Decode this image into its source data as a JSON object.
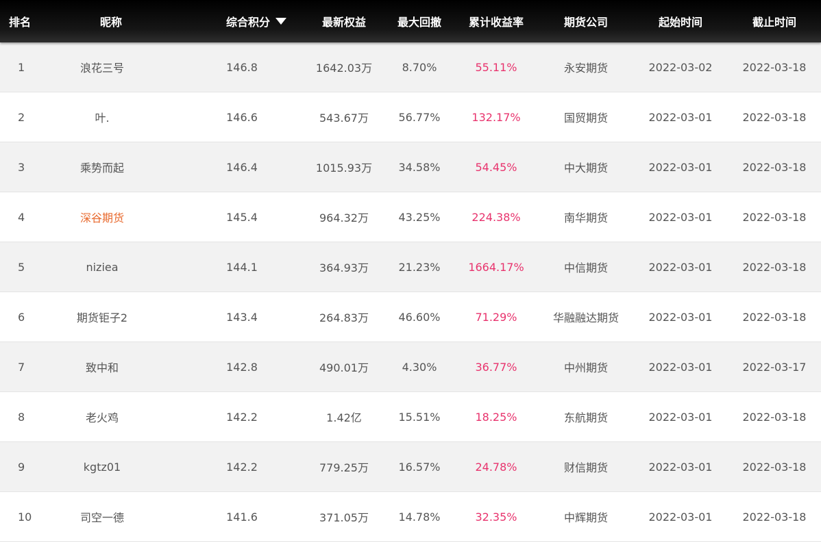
{
  "colors": {
    "header_bg": "#000000",
    "return_text": "#e8336d",
    "highlight_name": "#e8692d",
    "row_alt_bg": "#f2f2f2"
  },
  "headers": {
    "rank": "排名",
    "name": "昵称",
    "score": "综合积分",
    "equity": "最新权益",
    "drawdown": "最大回撤",
    "return": "累计收益率",
    "company": "期货公司",
    "start": "起始时间",
    "end": "截止时间",
    "sort_icon": "caret-down-icon"
  },
  "rows": [
    {
      "rank": "1",
      "name": "浪花三号",
      "score": "146.8",
      "equity": "1642.03万",
      "drawdown": "8.70%",
      "return": "55.11%",
      "company": "永安期货",
      "start": "2022-03-02",
      "end": "2022-03-18"
    },
    {
      "rank": "2",
      "name": "叶.",
      "score": "146.6",
      "equity": "543.67万",
      "drawdown": "56.77%",
      "return": "132.17%",
      "company": "国贸期货",
      "start": "2022-03-01",
      "end": "2022-03-18"
    },
    {
      "rank": "3",
      "name": "乘势而起",
      "score": "146.4",
      "equity": "1015.93万",
      "drawdown": "34.58%",
      "return": "54.45%",
      "company": "中大期货",
      "start": "2022-03-01",
      "end": "2022-03-18"
    },
    {
      "rank": "4",
      "name": "深谷期货",
      "score": "145.4",
      "equity": "964.32万",
      "drawdown": "43.25%",
      "return": "224.38%",
      "company": "南华期货",
      "start": "2022-03-01",
      "end": "2022-03-18"
    },
    {
      "rank": "5",
      "name": "niziea",
      "score": "144.1",
      "equity": "364.93万",
      "drawdown": "21.23%",
      "return": "1664.17%",
      "company": "中信期货",
      "start": "2022-03-01",
      "end": "2022-03-18"
    },
    {
      "rank": "6",
      "name": "期货钜子2",
      "score": "143.4",
      "equity": "264.83万",
      "drawdown": "46.60%",
      "return": "71.29%",
      "company": "华融融达期货",
      "start": "2022-03-01",
      "end": "2022-03-18"
    },
    {
      "rank": "7",
      "name": "致中和",
      "score": "142.8",
      "equity": "490.01万",
      "drawdown": "4.30%",
      "return": "36.77%",
      "company": "中州期货",
      "start": "2022-03-01",
      "end": "2022-03-17"
    },
    {
      "rank": "8",
      "name": "老火鸡",
      "score": "142.2",
      "equity": "1.42亿",
      "drawdown": "15.51%",
      "return": "18.25%",
      "company": "东航期货",
      "start": "2022-03-01",
      "end": "2022-03-18"
    },
    {
      "rank": "9",
      "name": "kgtz01",
      "score": "142.2",
      "equity": "779.25万",
      "drawdown": "16.57%",
      "return": "24.78%",
      "company": "财信期货",
      "start": "2022-03-01",
      "end": "2022-03-18"
    },
    {
      "rank": "10",
      "name": "司空一德",
      "score": "141.6",
      "equity": "371.05万",
      "drawdown": "14.78%",
      "return": "32.35%",
      "company": "中辉期货",
      "start": "2022-03-01",
      "end": "2022-03-18"
    }
  ]
}
